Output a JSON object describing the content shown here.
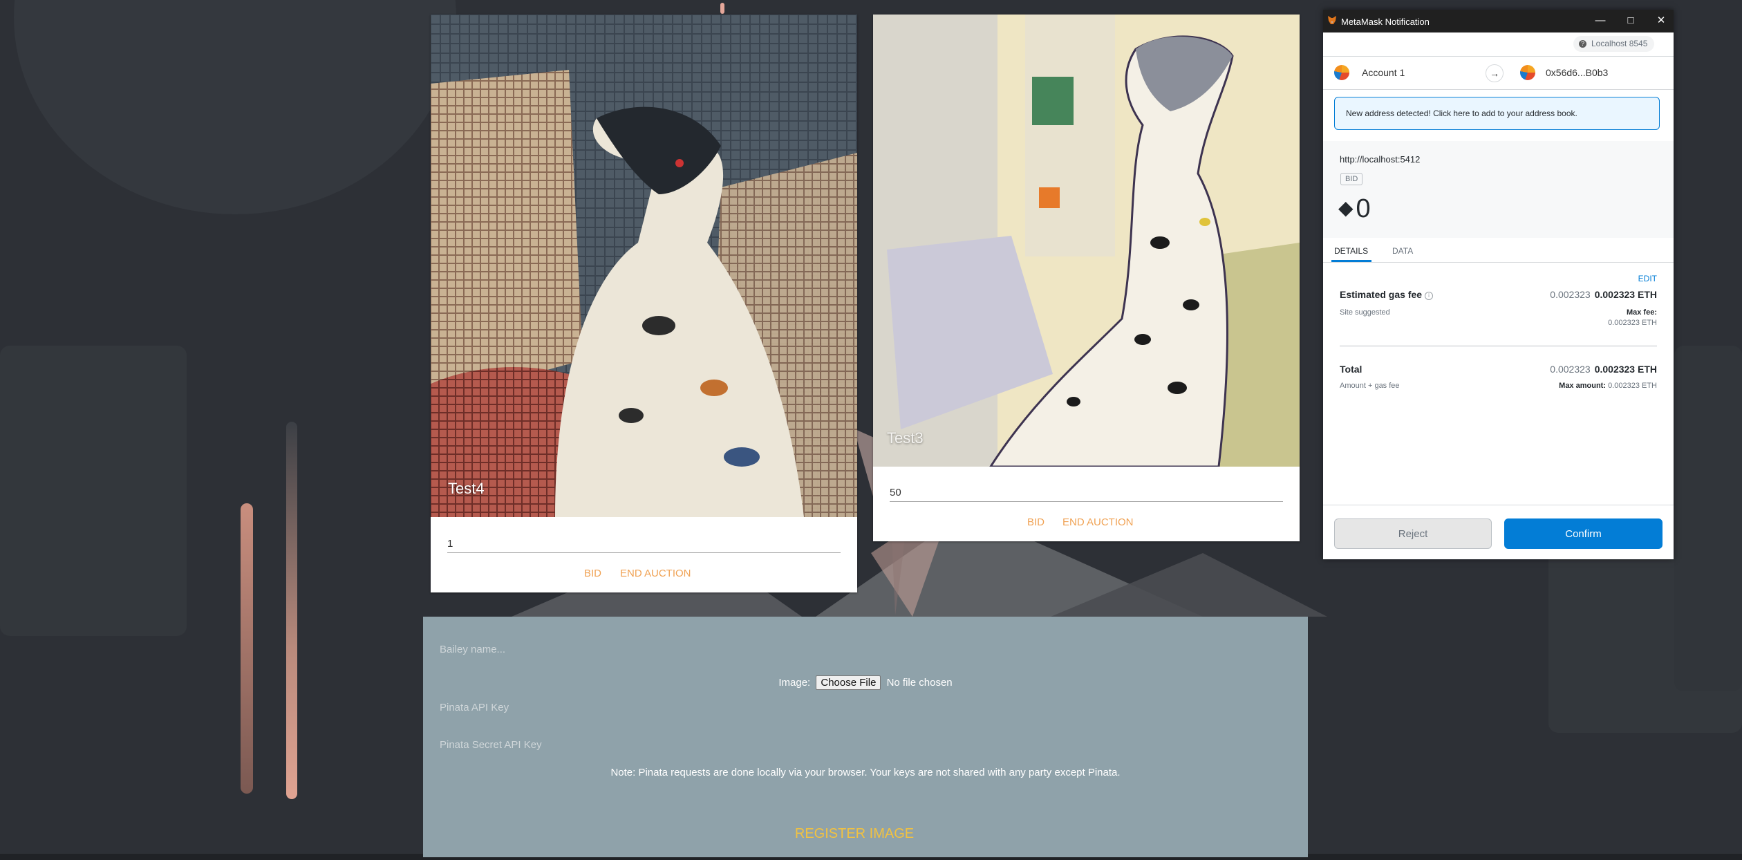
{
  "cards": [
    {
      "name": "Test4",
      "bid_value": "1",
      "bid_label": "BID",
      "end_label": "END AUCTION"
    },
    {
      "name": "Test3",
      "bid_value": "50",
      "bid_label": "BID",
      "end_label": "END AUCTION"
    }
  ],
  "form": {
    "name_placeholder": "Bailey name...",
    "image_label": "Image:",
    "choose_file_label": "Choose File",
    "no_file_text": "No file chosen",
    "pinata_key_placeholder": "Pinata API Key",
    "pinata_secret_placeholder": "Pinata Secret API Key",
    "note": "Note: Pinata requests are done locally via your browser. Your keys are not shared with any party except Pinata.",
    "register_label": "REGISTER IMAGE"
  },
  "metamask": {
    "window_title": "MetaMask Notification",
    "network": "Localhost 8545",
    "from_account": "Account 1",
    "to_address": "0x56d6...B0b3",
    "alert": "New address detected! Click here to add to your address book.",
    "origin": "http://localhost:5412",
    "method_badge": "BID",
    "amount": "0",
    "tabs": [
      "DETAILS",
      "DATA"
    ],
    "edit_label": "EDIT",
    "gas_label": "Estimated gas fee",
    "gas_sub": "Site suggested",
    "gas_value_muted": "0.002323",
    "gas_value": "0.002323 ETH",
    "max_fee_label": "Max fee:",
    "max_fee_value": "0.002323 ETH",
    "total_label": "Total",
    "total_sub": "Amount + gas fee",
    "total_value_muted": "0.002323",
    "total_value": "0.002323 ETH",
    "max_amount_label": "Max amount:",
    "max_amount_value": "0.002323 ETH",
    "reject_label": "Reject",
    "confirm_label": "Confirm",
    "accent_color": "#037dd6"
  }
}
